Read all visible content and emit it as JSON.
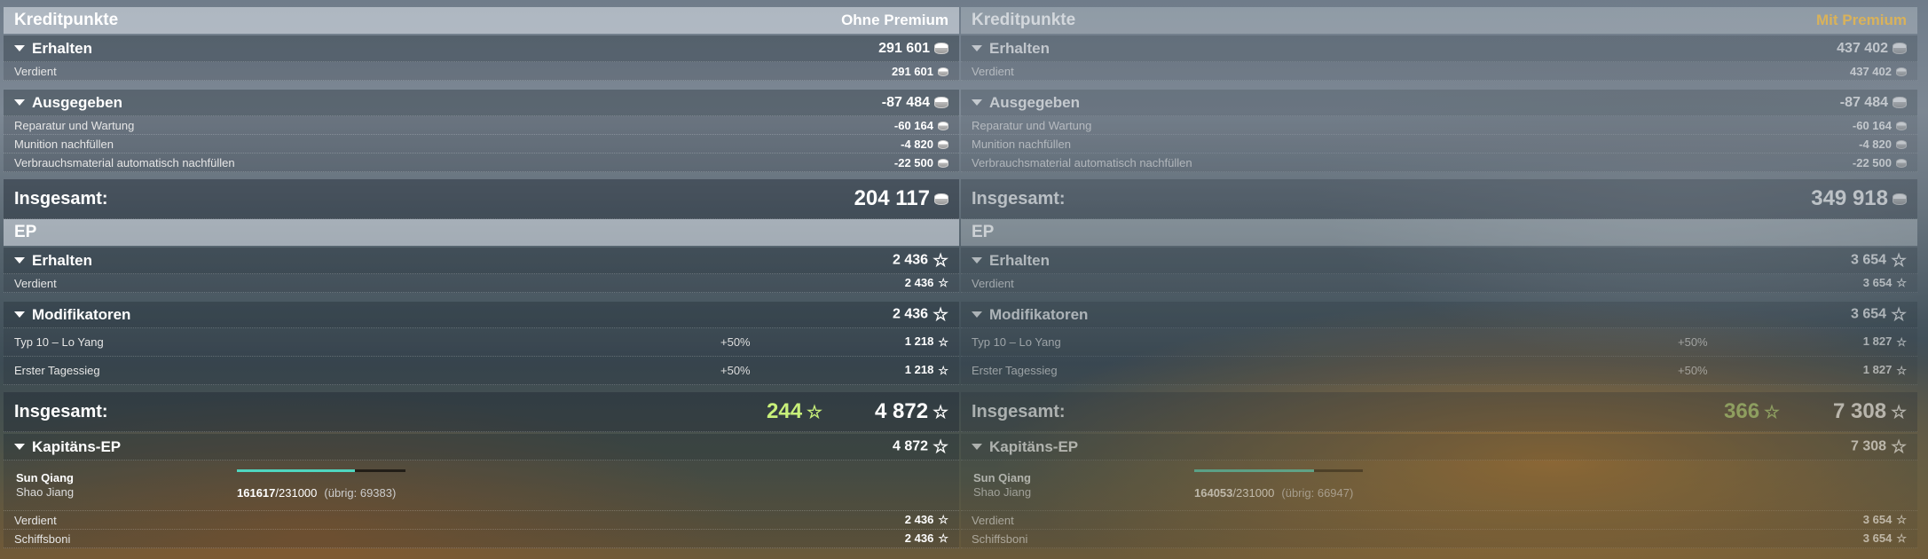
{
  "left": {
    "credits": {
      "title": "Kreditpunkte",
      "premium": "Ohne Premium",
      "received": {
        "label": "Erhalten",
        "value": "291 601"
      },
      "earned": {
        "label": "Verdient",
        "value": "291 601"
      },
      "spent": {
        "label": "Ausgegeben",
        "value": "-87 484"
      },
      "repair": {
        "label": "Reparatur und Wartung",
        "value": "-60 164"
      },
      "ammo": {
        "label": "Munition nachfüllen",
        "value": "-4 820"
      },
      "consumables": {
        "label": "Verbrauchsmaterial automatisch nachfüllen",
        "value": "-22 500"
      },
      "total": {
        "label": "Insgesamt:",
        "value": "204 117"
      }
    },
    "xp": {
      "title": "EP",
      "received": {
        "label": "Erhalten",
        "value": "2 436"
      },
      "earned": {
        "label": "Verdient",
        "value": "2 436"
      },
      "modifiers": {
        "label": "Modifikatoren",
        "value": "2 436"
      },
      "mod1": {
        "label": "Typ 10 – Lo Yang",
        "pct": "+50%",
        "value": "1 218"
      },
      "mod2": {
        "label": "Erster Tagessieg",
        "pct": "+50%",
        "value": "1 218"
      },
      "total": {
        "label": "Insgesamt:",
        "bonus": "244",
        "value": "4 872"
      }
    },
    "captain": {
      "title": "Kapitäns-EP",
      "value": "4 872",
      "name": "Sun Qiang",
      "subname": "Shao Jiang",
      "xp_current": "161617",
      "xp_max": "/231000",
      "xp_remaining": "(übrig: 69383)",
      "progress": 0.7,
      "earned": {
        "label": "Verdient",
        "value": "2 436"
      },
      "shipbonus": {
        "label": "Schiffsboni",
        "value": "2 436"
      }
    }
  },
  "right": {
    "credits": {
      "title": "Kreditpunkte",
      "premium": "Mit Premium",
      "received": {
        "label": "Erhalten",
        "value": "437 402"
      },
      "earned": {
        "label": "Verdient",
        "value": "437 402"
      },
      "spent": {
        "label": "Ausgegeben",
        "value": "-87 484"
      },
      "repair": {
        "label": "Reparatur und Wartung",
        "value": "-60 164"
      },
      "ammo": {
        "label": "Munition nachfüllen",
        "value": "-4 820"
      },
      "consumables": {
        "label": "Verbrauchsmaterial automatisch nachfüllen",
        "value": "-22 500"
      },
      "total": {
        "label": "Insgesamt:",
        "value": "349 918"
      }
    },
    "xp": {
      "title": "EP",
      "received": {
        "label": "Erhalten",
        "value": "3 654"
      },
      "earned": {
        "label": "Verdient",
        "value": "3 654"
      },
      "modifiers": {
        "label": "Modifikatoren",
        "value": "3 654"
      },
      "mod1": {
        "label": "Typ 10 – Lo Yang",
        "pct": "+50%",
        "value": "1 827"
      },
      "mod2": {
        "label": "Erster Tagessieg",
        "pct": "+50%",
        "value": "1 827"
      },
      "total": {
        "label": "Insgesamt:",
        "bonus": "366",
        "value": "7 308"
      }
    },
    "captain": {
      "title": "Kapitäns-EP",
      "value": "7 308",
      "name": "Sun Qiang",
      "subname": "Shao Jiang",
      "xp_current": "164053",
      "xp_max": "/231000",
      "xp_remaining": "(übrig: 66947)",
      "progress": 0.71,
      "earned": {
        "label": "Verdient",
        "value": "3 654"
      },
      "shipbonus": {
        "label": "Schiffsboni",
        "value": "3 654"
      }
    }
  },
  "colors": {
    "bonus_xp": "#c8f07a",
    "premium_gold": "#d9b25a",
    "progress": "#4fd6c0"
  },
  "icons": {
    "credits": "coin-icon",
    "xp": "star-icon",
    "collapse": "triangle-down-icon"
  }
}
